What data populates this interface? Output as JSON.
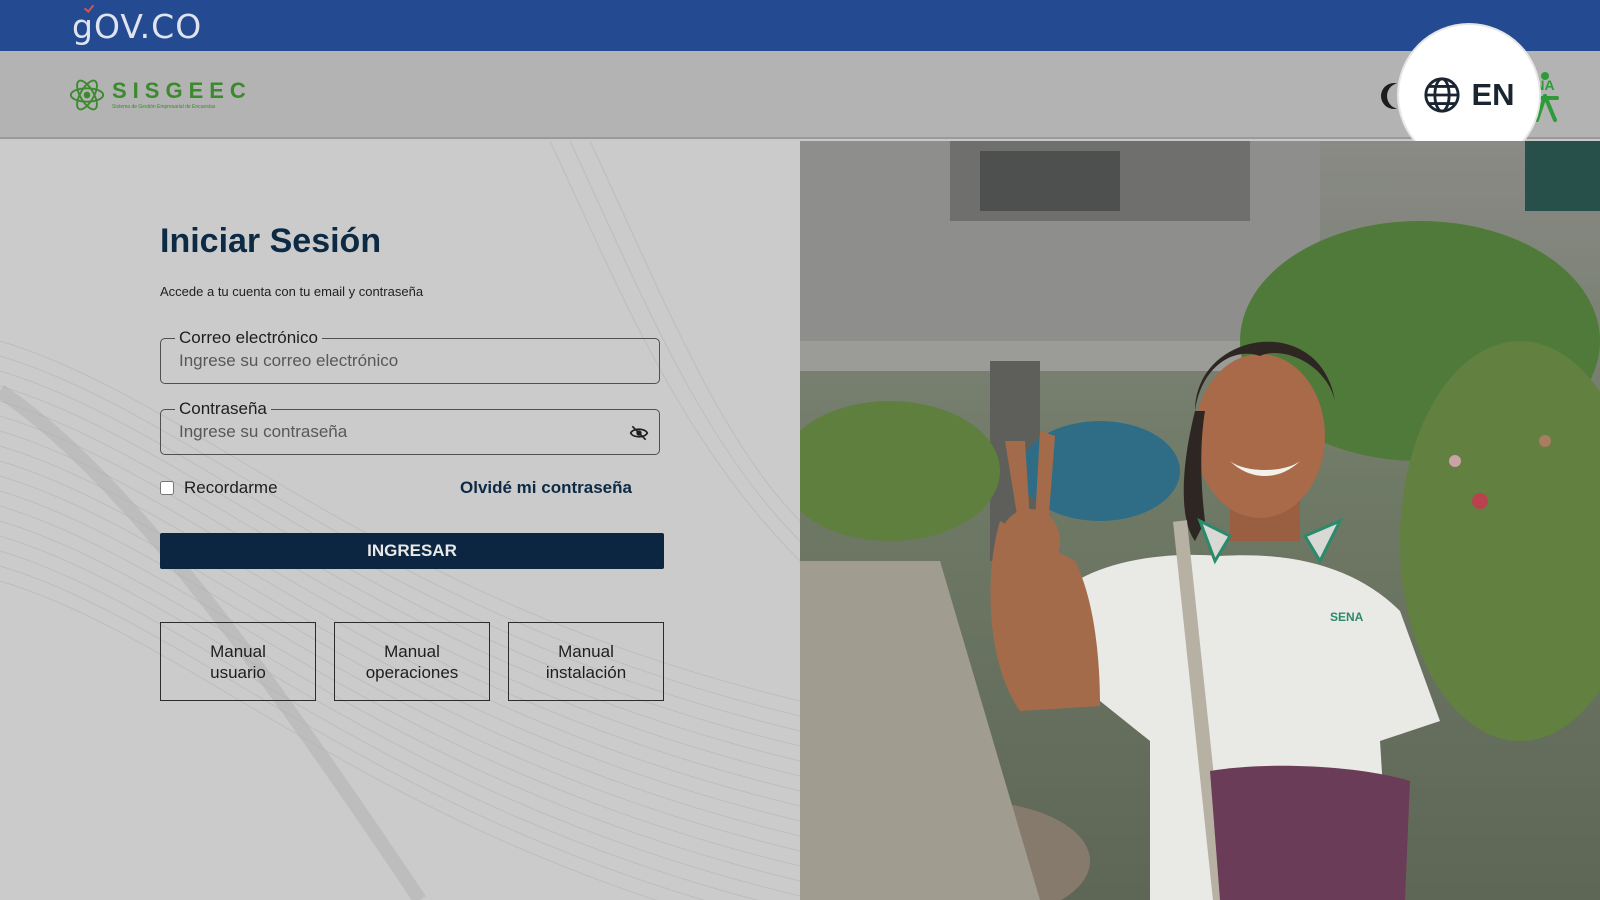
{
  "govbar": {
    "logo_text": "OV.CO",
    "logo_g": "g"
  },
  "header": {
    "brand_name": "SISGEEC",
    "brand_subtitle": "Sistema de Gestión Empresarial de Encuestas",
    "language_label": "EN",
    "icons": [
      "moon-icon",
      "globe-icon",
      "sena-logo"
    ]
  },
  "login": {
    "title": "Iniciar Sesión",
    "subtitle": "Accede a tu cuenta con tu email y contraseña",
    "email_label": "Correo electrónico",
    "email_placeholder": "Ingrese su correo electrónico",
    "email_value": "",
    "password_label": "Contraseña",
    "password_placeholder": "Ingrese su contraseña",
    "password_value": "",
    "remember_label": "Recordarme",
    "remember_checked": false,
    "forgot_label": "Olvidé mi contraseña",
    "submit_label": "INGRESAR"
  },
  "manuals": [
    {
      "line1": "Manual",
      "line2": "usuario"
    },
    {
      "line1": "Manual",
      "line2": "operaciones"
    },
    {
      "line1": "Manual",
      "line2": "instalación"
    }
  ],
  "colors": {
    "gov_blue": "#244a92",
    "brand_green": "#3c8a2e",
    "primary_navy": "#0c2642",
    "overlay_gray": "#b3b3b3"
  }
}
